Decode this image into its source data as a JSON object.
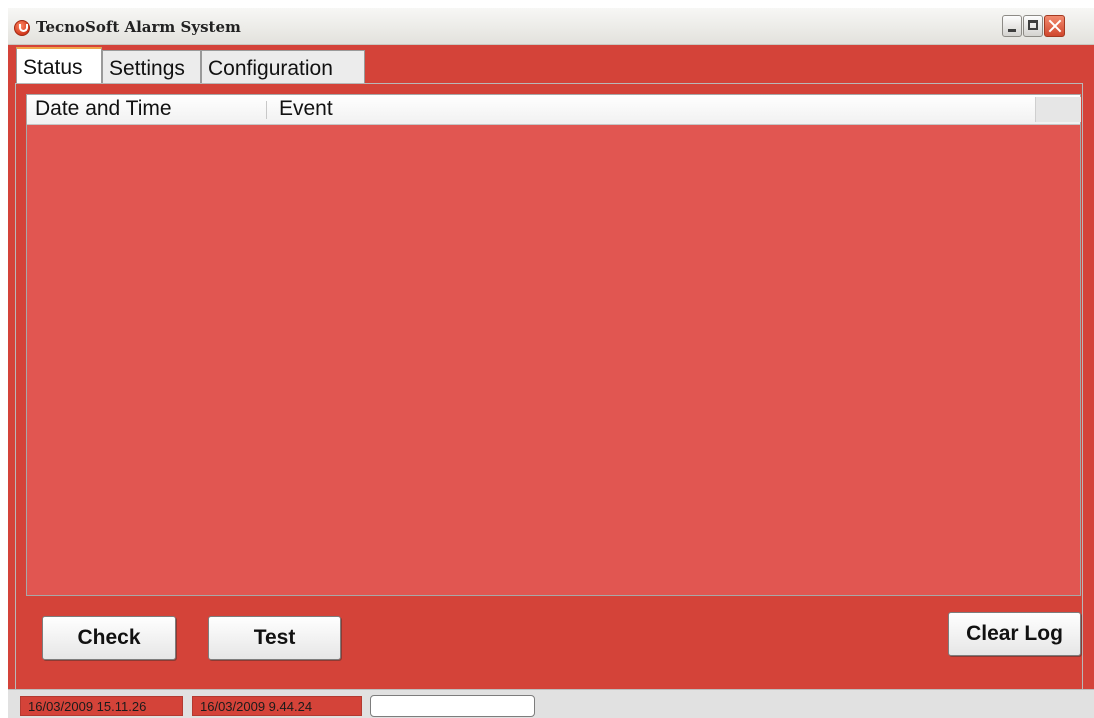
{
  "window": {
    "title": "TecnoSoft Alarm System",
    "accent_color": "#d44339",
    "log_area_color": "#e15651"
  },
  "tabs": [
    {
      "label": "Status",
      "active": true
    },
    {
      "label": "Settings",
      "active": false
    },
    {
      "label": "Configuration",
      "active": false
    }
  ],
  "log_table": {
    "columns": [
      "Date and Time",
      "Event"
    ],
    "rows": []
  },
  "buttons": {
    "check": "Check",
    "test": "Test",
    "clear_log": "Clear Log"
  },
  "status_bar": {
    "field1": "16/03/2009 15.11.26",
    "field2": "16/03/2009 9.44.24"
  },
  "icons": [
    "alarm-app-icon",
    "minimize-icon",
    "maximize-icon",
    "close-icon"
  ]
}
